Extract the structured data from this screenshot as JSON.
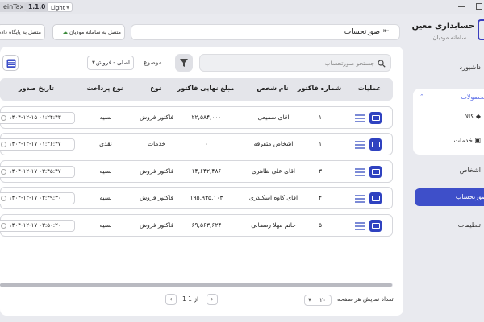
{
  "titlebar": {
    "app_name": "einTax",
    "version": "1.1.0",
    "theme": "Light"
  },
  "sidebar": {
    "title": "حسابداری معین",
    "subtitle": "سامانه مودیان",
    "items": {
      "dashboard": "داشبورد",
      "products": "محصولات",
      "goods": "کالا",
      "services": "خدمات",
      "persons": "اشخاص",
      "invoices": "صورتحساب",
      "settings": "تنظیمات"
    }
  },
  "header": {
    "page_title": "صورتحساب",
    "connect_db": "متصل به پایگاه داده",
    "connect_moadian": "متصل به سامانه مودیان"
  },
  "filters": {
    "search_placeholder": "جستجو صورتحساب",
    "subject_label": "موضوع",
    "subject_value": "اصلی - فروش"
  },
  "table": {
    "headers": {
      "ops": "عملیات",
      "invoice_no": "شماره فاکتور",
      "person": "نام شخص",
      "amount": "مبلغ نهایی فاکتور",
      "type": "نوع",
      "payment": "نوع پرداخت",
      "date": "تاریخ صدور"
    },
    "rows": [
      {
        "invoice_no": "۱",
        "person": "اقای سمیعی",
        "amount": "۲۲,۵۸۴,۰۰۰",
        "type": "فاکتور فروش",
        "payment": "نسیه",
        "date": "۱۴۰۴-۱۲-۱۵ ۰۱:۲۴:۴۳"
      },
      {
        "invoice_no": "۱",
        "person": "اشخاص متفرقه",
        "amount": "۰",
        "type": "خدمات",
        "payment": "نقدی",
        "date": "۱۴۰۴-۱۲-۱۷ ۰۱:۲۶:۴۷"
      },
      {
        "invoice_no": "۳",
        "person": "اقای علی ظاهری",
        "amount": "۱۴,۶۴۲,۴۸۶",
        "type": "فاکتور فروش",
        "payment": "نسیه",
        "date": "۱۴۰۴-۱۲-۱۷ ۰۳:۴۵:۴۷"
      },
      {
        "invoice_no": "۴",
        "person": "اقای کاوه اسکندری",
        "amount": "۱۹۵,۹۳۵,۱۰۳",
        "type": "فاکتور فروش",
        "payment": "نسیه",
        "date": "۱۴۰۴-۱۲-۱۷ ۰۳:۴۹:۳۰"
      },
      {
        "invoice_no": "۵",
        "person": "خانم مهلا رمضانی",
        "amount": "۶۹,۵۶۳,۶۲۴",
        "type": "فاکتور فروش",
        "payment": "نسیه",
        "date": "۱۴۰۴-۱۲-۱۷ ۰۳:۵۰:۲۰"
      }
    ]
  },
  "footer": {
    "per_page_label": "تعداد نمایش هر صفحه",
    "per_page_value": "۲۰",
    "page_current": "1",
    "page_of": "از",
    "page_total": "1"
  },
  "colors": {
    "accent": "#3e4fc9",
    "panel": "#ffffff",
    "background": "#e9eaef"
  }
}
